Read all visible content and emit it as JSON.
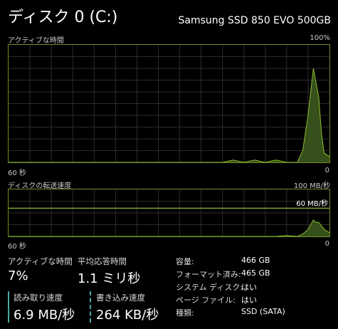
{
  "header": {
    "title": "ディスク 0 (C:)",
    "model": "Samsung SSD 850 EVO 500GB"
  },
  "active_time_graph": {
    "label": "アクティブな時間",
    "max_label": "100%",
    "time_label": "60 秒",
    "min_label": "0"
  },
  "transfer_graph": {
    "label": "ディスクの転送速度",
    "max_label": "100 MB/秒",
    "ref_label": "60 MB/秒",
    "time_label": "60 秒",
    "min_label": "0"
  },
  "stats": {
    "active_time_label": "アクティブな時間",
    "active_time_value": "7%",
    "response_label": "平均応答時間",
    "response_value": "1.1 ミリ秒",
    "read_label": "読み取り速度",
    "read_value": "6.9 MB/秒",
    "write_label": "書き込み速度",
    "write_value": "264 KB/秒"
  },
  "properties": [
    {
      "label": "容量:",
      "value": "466 GB"
    },
    {
      "label": "フォーマット済み:",
      "value": "465 GB"
    },
    {
      "label": "システム ディスク:",
      "value": "はい"
    },
    {
      "label": "ページ ファイル:",
      "value": "はい"
    },
    {
      "label": "種類:",
      "value": "SSD (SATA)"
    }
  ],
  "colors": {
    "background": "#000000",
    "graph_border": "#6f8e21",
    "grid": "#2c2c2c",
    "line": "#8dbb2f",
    "fill": "#35501a",
    "read_write_marker": "#4aa7a6"
  },
  "chart_data": [
    {
      "type": "area",
      "title": "アクティブな時間",
      "x_unit": "seconds ago",
      "xlim": [
        60,
        0
      ],
      "ylim": [
        0,
        100
      ],
      "y_unit": "%",
      "x": [
        60,
        20,
        18,
        16,
        14,
        12,
        10,
        8,
        6,
        5,
        4,
        3,
        2,
        1.5,
        1,
        0
      ],
      "values": [
        0,
        0,
        2,
        0,
        2,
        0,
        2,
        0,
        0,
        10,
        40,
        80,
        55,
        25,
        8,
        5
      ]
    },
    {
      "type": "area",
      "title": "ディスクの転送速度",
      "x_unit": "seconds ago",
      "xlim": [
        60,
        0
      ],
      "ylim": [
        0,
        100
      ],
      "y_unit": "MB/秒",
      "reference_line": 60,
      "x": [
        60,
        10,
        8,
        6,
        5,
        4,
        3,
        2.5,
        2,
        1,
        0
      ],
      "values": [
        0,
        0,
        2,
        0,
        5,
        15,
        35,
        30,
        30,
        15,
        8
      ]
    }
  ]
}
